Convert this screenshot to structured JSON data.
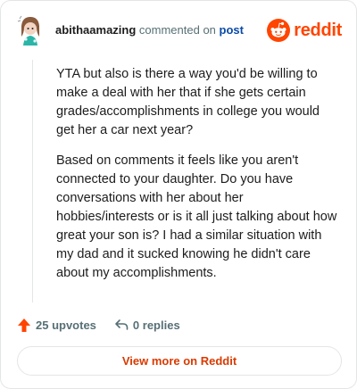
{
  "comment": {
    "author": "abithaamazing",
    "action_text": "commented on",
    "target_text": "post",
    "paragraphs": [
      "YTA but also is there a way you'd be willing to make a deal with her that if she gets certain grades/accomplishments in college you would get her a car next year?",
      "Based on comments it feels like you aren't connected to your daughter. Do you have conversations with her about her hobbies/interests or is it all just talking about how great your son is? I had a similar situation with my dad and it sucked knowing he didn't care about my accomplishments."
    ]
  },
  "brand": {
    "name": "reddit",
    "color": "#ff4500"
  },
  "actions": {
    "upvotes_label": "25 upvotes",
    "replies_label": "0 replies",
    "upvote_icon": "upvote-arrow-icon",
    "reply_icon": "reply-arrow-icon"
  },
  "footer": {
    "view_more_label": "View more on Reddit"
  },
  "colors": {
    "accent": "#ff4500",
    "link": "#0a4aa8",
    "muted": "#576f76",
    "button_text": "#d93a00"
  }
}
